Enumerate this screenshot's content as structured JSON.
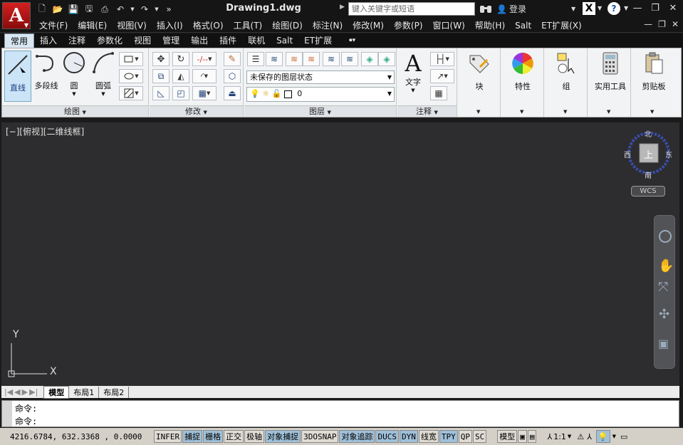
{
  "app": {
    "document_title": "Drawing1.dwg",
    "search_placeholder": "键入关键字或短语",
    "login_label": "登录",
    "logo_letter": "A"
  },
  "menu": [
    "文件(F)",
    "编辑(E)",
    "视图(V)",
    "插入(I)",
    "格式(O)",
    "工具(T)",
    "绘图(D)",
    "标注(N)",
    "修改(M)",
    "参数(P)",
    "窗口(W)",
    "帮助(H)",
    "Salt",
    "ET扩展(X)"
  ],
  "ribbon_tabs": [
    "常用",
    "插入",
    "注释",
    "参数化",
    "视图",
    "管理",
    "输出",
    "插件",
    "联机",
    "Salt",
    "ET扩展"
  ],
  "ribbon": {
    "draw": {
      "label": "绘图",
      "line": "直线",
      "polyline": "多段线",
      "circle": "圆",
      "arc": "圆弧"
    },
    "modify": {
      "label": "修改"
    },
    "layers": {
      "label": "图层",
      "layer_state": "未保存的图层状态",
      "current_layer": "0"
    },
    "annotation": {
      "label": "注释",
      "text": "文字"
    },
    "block": {
      "label": "块"
    },
    "properties": {
      "label": "特性"
    },
    "group": {
      "label": "组"
    },
    "utilities": {
      "label": "实用工具"
    },
    "clipboard": {
      "label": "剪贴板"
    }
  },
  "viewport": {
    "label": "[−][俯视][二维线框]",
    "viewcube": {
      "north": "北",
      "south": "南",
      "west": "西",
      "east": "东",
      "top": "上"
    },
    "wcs": "WCS",
    "ucs_x": "X",
    "ucs_y": "Y"
  },
  "layout_tabs": [
    "模型",
    "布局1",
    "布局2"
  ],
  "command": {
    "line1": "命令:",
    "line2": "命令:"
  },
  "status": {
    "coords": "4216.6784, 632.3368 , 0.0000",
    "toggles": [
      {
        "label": "INFER",
        "on": false
      },
      {
        "label": "捕捉",
        "on": true
      },
      {
        "label": "栅格",
        "on": true
      },
      {
        "label": "正交",
        "on": false
      },
      {
        "label": "极轴",
        "on": false
      },
      {
        "label": "对象捕捉",
        "on": true
      },
      {
        "label": "3DOSNAP",
        "on": false
      },
      {
        "label": "对象追踪",
        "on": true
      },
      {
        "label": "DUCS",
        "on": true
      },
      {
        "label": "DYN",
        "on": true
      },
      {
        "label": "线宽",
        "on": false
      },
      {
        "label": "TPY",
        "on": true
      },
      {
        "label": "QP",
        "on": false
      },
      {
        "label": "SC",
        "on": false
      }
    ],
    "model": "模型",
    "scale": "1:1"
  },
  "colors": {
    "canvas": "#2d2d2f",
    "ribbon": "#f2f3f5",
    "accent": "#d42020",
    "status_on": "#9fc0d9"
  }
}
